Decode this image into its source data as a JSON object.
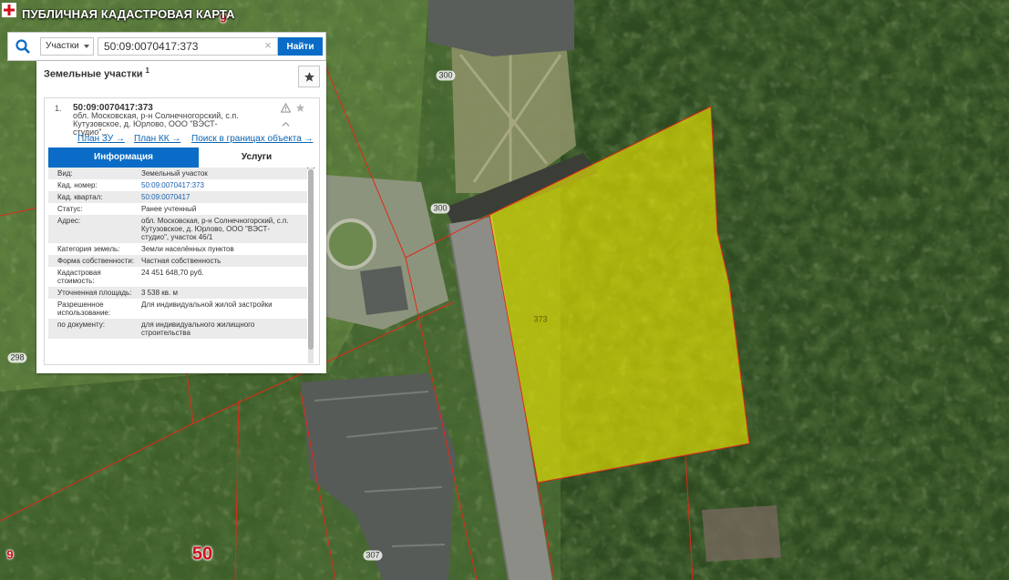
{
  "app": {
    "title": "ПУБЛИЧНАЯ КАДАСТРОВАЯ КАРТА"
  },
  "search": {
    "type_label": "Участки",
    "value": "50:09:0070417:373",
    "clear_glyph": "×",
    "button_label": "Найти"
  },
  "results": {
    "header": "Земельные участки",
    "count": "1"
  },
  "result": {
    "index": "1.",
    "number": "50:09:0070417:373",
    "address": "обл. Московская, р-н Солнечногорский, с.п. Кутузовское, д. Юрлово, ООО \"ВЭСТ-студио\"...",
    "links": [
      "План ЗУ →",
      "План КК →",
      "Поиск в границах объекта →"
    ]
  },
  "tabs": [
    "Информация",
    "Услуги"
  ],
  "info": {
    "rows": [
      {
        "label": "Вид:",
        "value": "Земельный участок"
      },
      {
        "label": "Кад. номер:",
        "value": "50:09:0070417:373"
      },
      {
        "label": "Кад. квартал:",
        "value": "50:09:0070417"
      },
      {
        "label": "Статус:",
        "value": "Ранее учтенный"
      },
      {
        "label": "Адрес:",
        "value": "обл. Московская, р-н Солнечногорский, с.п. Кутузовское, д. Юрлово, ООО \"ВЭСТ-студио\", участок 46/1"
      },
      {
        "label": "Категория земель:",
        "value": "Земли населённых пунктов"
      },
      {
        "label": "Форма собственности:",
        "value": "Частная собственность"
      },
      {
        "label": "Кадастровая стоимость:",
        "value": "24 451 648,70 руб."
      },
      {
        "label": "Уточненная площадь:",
        "value": "3 538 кв. м"
      },
      {
        "label": "Разрешенное использование:",
        "value": "Для индивидуальной жилой застройки"
      },
      {
        "label": "по документу:",
        "value": "для индивидуального жилищного строительства"
      }
    ]
  },
  "map": {
    "labels": [
      "9",
      "300",
      "300",
      "373",
      "298",
      "307",
      "9",
      "50"
    ]
  },
  "icons": [
    "logo-icon",
    "search-icon",
    "chevron-down-icon",
    "clear-icon",
    "star-icon",
    "warning-icon",
    "star-outline-icon",
    "chevron-up-icon"
  ],
  "colors": {
    "accent": "#0a6cc6",
    "parcel_fill": "#f0ec00",
    "boundary": "#e02a1a",
    "label_red": "#d0101c"
  }
}
